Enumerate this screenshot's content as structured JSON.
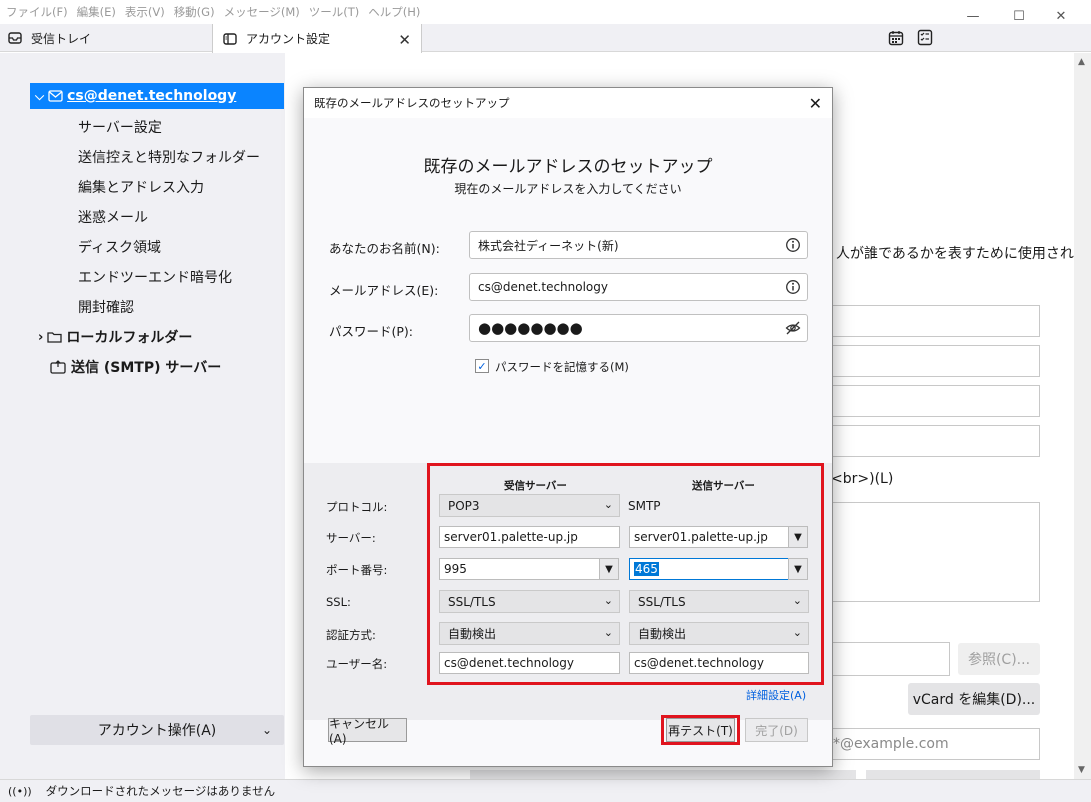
{
  "menubar": {
    "items": [
      "ファイル(F)",
      "編集(E)",
      "表示(V)",
      "移動(G)",
      "メッセージ(M)",
      "ツール(T)",
      "ヘルプ(H)"
    ]
  },
  "window_controls": {
    "minimize": "—",
    "maximize": "☐",
    "close": "✕"
  },
  "tabs": {
    "inbox": "受信トレイ",
    "account_settings": "アカウント設定",
    "close": "✕"
  },
  "sidebar": {
    "account": "cs@denet.technology",
    "items": [
      "サーバー設定",
      "送信控えと特別なフォルダー",
      "編集とアドレス入力",
      "迷惑メール",
      "ディスク領域",
      "エンドツーエンド暗号化",
      "開封確認"
    ],
    "local_folders": "ローカルフォルダー",
    "smtp": "送信 (SMTP) サーバー",
    "account_actions": "アカウント操作(A)"
  },
  "background_page": {
    "partial_text": "人が誰であるかを表すために使用され",
    "br_label": "<br>)(L)",
    "browse_button": "参照(C)...",
    "vcard_button": "vCard を編集(D)...",
    "email_placeholder": "*@example.com"
  },
  "statusbar": {
    "text": "ダウンロードされたメッセージはありません"
  },
  "dialog": {
    "title": "既存のメールアドレスのセットアップ",
    "heading": "既存のメールアドレスのセットアップ",
    "subheading": "現在のメールアドレスを入力してください",
    "name_label": "あなたのお名前(N):",
    "name_value": "株式会社ディーネット(新)",
    "email_label": "メールアドレス(E):",
    "email_value": "cs@denet.technology",
    "password_label": "パスワード(P):",
    "password_value": "●●●●●●●●",
    "remember_password": "パスワードを記憶する(M)",
    "remember_checked": true,
    "incoming_header": "受信サーバー",
    "outgoing_header": "送信サーバー",
    "protocol_label": "プロトコル:",
    "protocol_in": "POP3",
    "protocol_out": "SMTP",
    "server_label": "サーバー:",
    "server_in": "server01.palette-up.jp",
    "server_out": "server01.palette-up.jp",
    "port_label": "ポート番号:",
    "port_in": "995",
    "port_out": "465",
    "ssl_label": "SSL:",
    "ssl_in": "SSL/TLS",
    "ssl_out": "SSL/TLS",
    "auth_label": "認証方式:",
    "auth_in": "自動検出",
    "auth_out": "自動検出",
    "user_label": "ユーザー名:",
    "user_in": "cs@denet.technology",
    "user_out": "cs@denet.technology",
    "advanced_link": "詳細設定(A)",
    "cancel_button": "キャンセル(A)",
    "retest_button": "再テスト(T)",
    "done_button": "完了(D)"
  },
  "colors": {
    "accent": "#0a84ff",
    "highlight_box": "#e0141e",
    "link": "#0060df"
  }
}
